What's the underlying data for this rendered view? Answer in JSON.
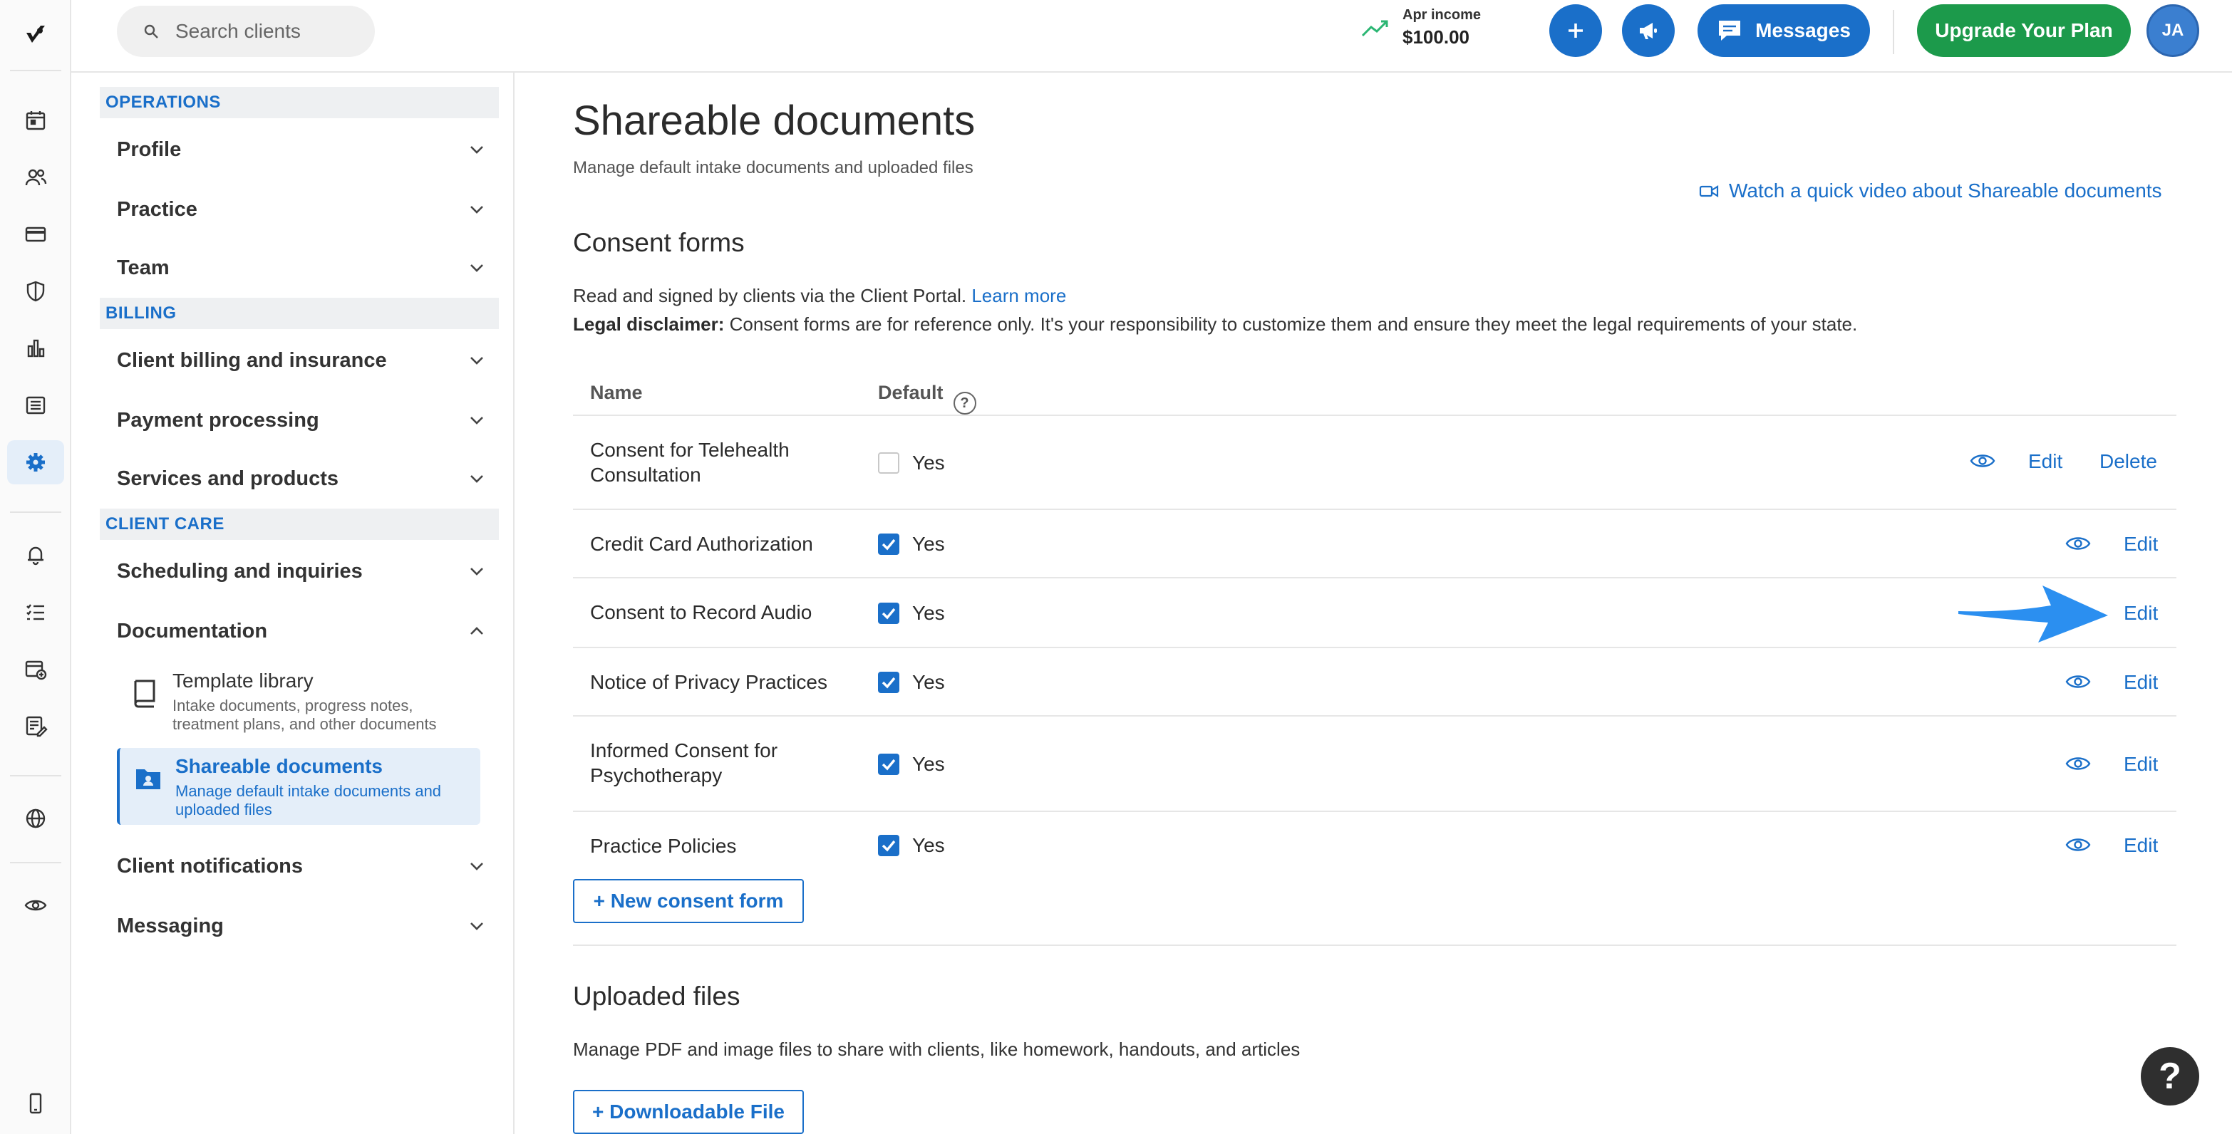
{
  "search": {
    "placeholder": "Search clients"
  },
  "income": {
    "label": "Apr income",
    "value": "$100.00"
  },
  "header": {
    "messages_label": "Messages",
    "upgrade_label": "Upgrade Your Plan",
    "avatar_initials": "JA"
  },
  "sidebar": {
    "sections": [
      {
        "title": "OPERATIONS",
        "items": [
          "Profile",
          "Practice",
          "Team"
        ]
      },
      {
        "title": "BILLING",
        "items": [
          "Client billing and insurance",
          "Payment processing",
          "Services and products"
        ]
      },
      {
        "title": "CLIENT CARE",
        "items": [
          "Scheduling and inquiries",
          "Documentation",
          "Client notifications",
          "Messaging"
        ]
      }
    ],
    "documentation_sub": [
      {
        "title": "Template library",
        "desc": "Intake documents, progress notes, treatment plans, and other documents"
      },
      {
        "title": "Shareable documents",
        "desc": "Manage default intake documents and uploaded files"
      }
    ]
  },
  "page": {
    "title": "Shareable documents",
    "subtitle": "Manage default intake documents and uploaded files",
    "video_link": "Watch a quick video about Shareable documents"
  },
  "consent": {
    "heading": "Consent forms",
    "intro": "Read and signed by clients via the Client Portal.",
    "learn_more": "Learn more",
    "disclaimer_label": "Legal disclaimer:",
    "disclaimer_text": "Consent forms are for reference only. It's your responsibility to customize them and ensure they meet the legal requirements of your state.",
    "columns": {
      "name": "Name",
      "default": "Default",
      "help": "?"
    },
    "rows": [
      {
        "name": "Consent for Telehealth Consultation",
        "default": "Yes",
        "checked": false,
        "actions": [
          "Edit",
          "Delete"
        ],
        "preview": true
      },
      {
        "name": "Credit Card Authorization",
        "default": "Yes",
        "checked": true,
        "actions": [
          "Edit"
        ],
        "preview": true
      },
      {
        "name": "Consent to Record Audio",
        "default": "Yes",
        "checked": true,
        "actions": [
          "Edit"
        ],
        "preview": false
      },
      {
        "name": "Notice of Privacy Practices",
        "default": "Yes",
        "checked": true,
        "actions": [
          "Edit"
        ],
        "preview": true
      },
      {
        "name": "Informed Consent for Psychotherapy",
        "default": "Yes",
        "checked": true,
        "actions": [
          "Edit"
        ],
        "preview": true
      },
      {
        "name": "Practice Policies",
        "default": "Yes",
        "checked": true,
        "actions": [
          "Edit"
        ],
        "preview": true
      }
    ],
    "new_button": "+ New consent form"
  },
  "uploaded": {
    "heading": "Uploaded files",
    "desc": "Manage PDF and image files to share with clients, like homework, handouts, and articles",
    "button": "+ Downloadable File"
  },
  "help_label": "?",
  "colors": {
    "accent": "#1a6fc9",
    "upgrade": "#1c9a4b",
    "arrow": "#2b8ff0"
  }
}
